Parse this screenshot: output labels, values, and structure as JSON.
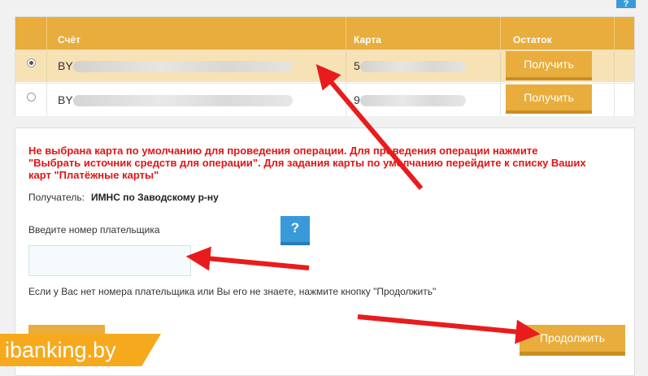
{
  "top_help": {
    "label": "?"
  },
  "accounts_table": {
    "headers": {
      "account": "Счёт",
      "card": "Карта",
      "balance": "Остаток"
    },
    "rows": [
      {
        "selected": true,
        "account_prefix": "BY",
        "card_prefix": "5",
        "get_label": "Получить"
      },
      {
        "selected": false,
        "account_prefix": "BY",
        "card_prefix": "9",
        "get_label": "Получить"
      }
    ]
  },
  "panel": {
    "warning": "Не выбрана карта по умолчанию для проведения операции. Для проведения операции нажмите \"Выбрать источник средств для операции\". Для задания карты по умолчанию перейдите к списку Ваших карт \"Платёжные карты\"",
    "recipient_label": "Получатель:",
    "recipient_value": "ИМНС по Заводскому р-ну",
    "payer_label": "Введите номер плательщика",
    "help_label": "?",
    "payer_input_value": "",
    "hint": "Если у Вас нет номера плательщика или Вы его не знаете, нажмите кнопку \"Продолжить\"",
    "continue_label": "Продолжить"
  },
  "watermark": "ibanking.by",
  "colors": {
    "accent": "#e8ad3d",
    "arrow": "#e81c1c",
    "warning": "#e31414",
    "help": "#3a9ad9"
  }
}
